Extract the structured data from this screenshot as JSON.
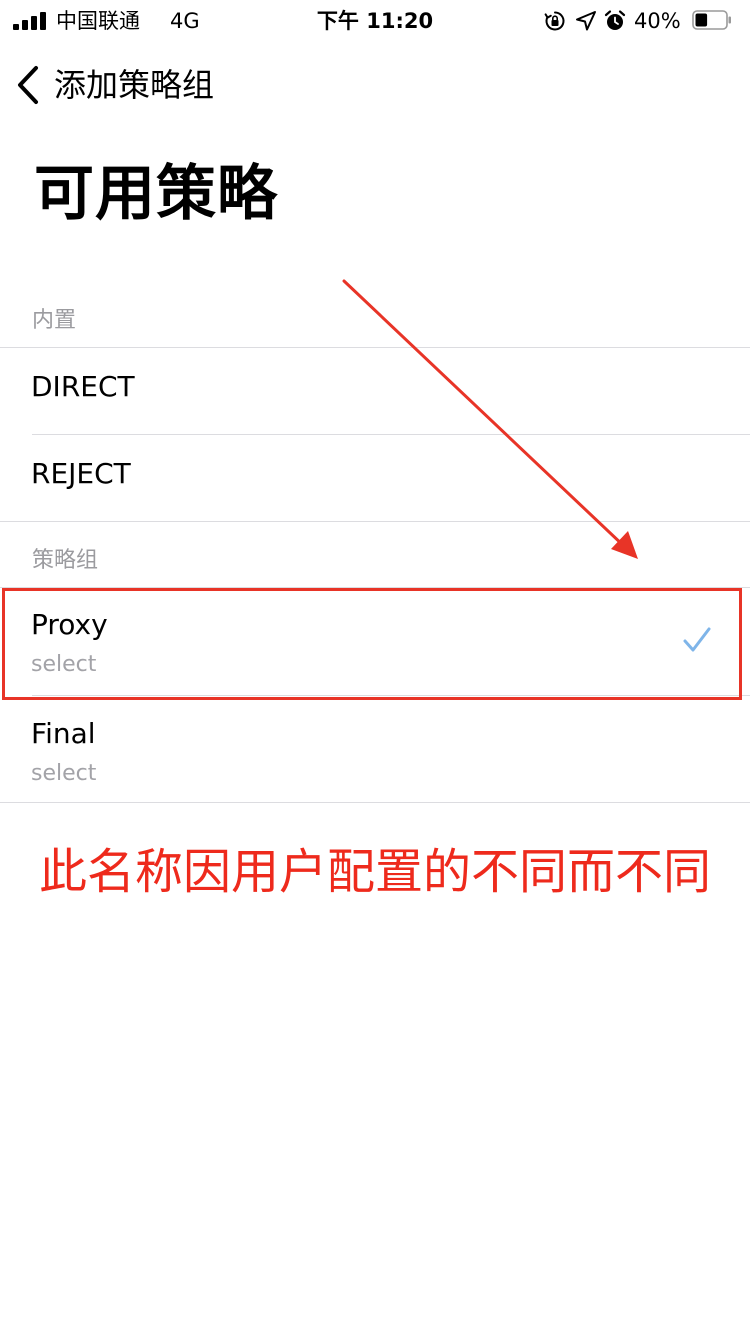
{
  "status_bar": {
    "carrier": "中国联通",
    "network": "4G",
    "time": "下午 11:20",
    "battery_percent": "40%",
    "battery_level": 0.4,
    "icons": [
      "signal-bars-icon",
      "rotation-lock-icon",
      "location-arrow-icon",
      "alarm-clock-icon",
      "battery-icon"
    ]
  },
  "nav": {
    "back_icon": "chevron-left-icon",
    "title": "添加策略组"
  },
  "page": {
    "title": "可用策略"
  },
  "sections": {
    "builtin": {
      "header": "内置",
      "items": [
        {
          "title": "DIRECT"
        },
        {
          "title": "REJECT"
        }
      ]
    },
    "policy_groups": {
      "header": "策略组",
      "items": [
        {
          "title": "Proxy",
          "subtitle": "select",
          "selected": true
        },
        {
          "title": "Final",
          "subtitle": "select",
          "selected": false
        }
      ]
    }
  },
  "annotation": {
    "text": "此名称因用户配置的不同而不同",
    "color": "#ee2a1c"
  },
  "colors": {
    "accent_check": "#7fb5e9",
    "separator": "#dcdce0",
    "secondary_text": "#9b9b9f",
    "annotation_red": "#e83427"
  }
}
